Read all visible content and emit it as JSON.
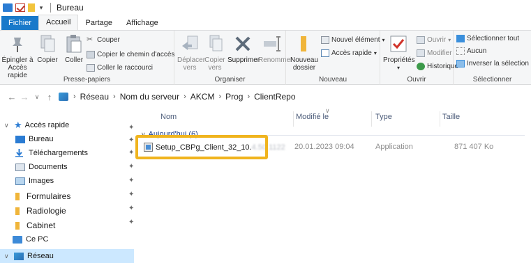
{
  "window": {
    "title": "Bureau"
  },
  "tabs": [
    "Fichier",
    "Accueil",
    "Partage",
    "Affichage"
  ],
  "ribbon": {
    "clipboard": {
      "pin_label": "Épingler à\nAccès rapide",
      "pin_line1": "Épingler à",
      "pin_line2": "Accès rapide",
      "copy": "Copier",
      "paste": "Coller",
      "cut": "Couper",
      "copy_path": "Copier le chemin d'accès",
      "paste_shortcut": "Coller le raccourci",
      "group": "Presse-papiers"
    },
    "organize": {
      "move_line1": "Déplacer",
      "move_line2": "vers",
      "copy_line1": "Copier",
      "copy_line2": "vers",
      "delete": "Supprimer",
      "rename": "Renommer",
      "group": "Organiser"
    },
    "new": {
      "new_folder_line1": "Nouveau",
      "new_folder_line2": "dossier",
      "new_item": "Nouvel élément",
      "quick_access": "Accès rapide",
      "group": "Nouveau"
    },
    "open": {
      "properties": "Propriétés",
      "open": "Ouvrir",
      "modify": "Modifier",
      "history": "Historique",
      "group": "Ouvrir"
    },
    "select": {
      "select_all": "Sélectionner tout",
      "none": "Aucun",
      "invert": "Inverser la sélection",
      "group": "Sélectionner"
    }
  },
  "breadcrumb": [
    "Réseau",
    "Nom du serveur",
    "AKCM",
    "Prog",
    "ClientRepo"
  ],
  "nav": {
    "quick_access": "Accès rapide",
    "items": [
      "Bureau",
      "Téléchargements",
      "Documents",
      "Images",
      "Formulaires",
      "Radiologie",
      "Cabinet"
    ],
    "this_pc": "Ce PC",
    "network": "Réseau"
  },
  "columns": {
    "name": "Nom",
    "modified": "Modifié le",
    "type": "Type",
    "size": "Taille"
  },
  "group_header": "Aujourd'hui (6)",
  "file": {
    "name": "Setup_CBPg_Client_32_10.",
    "name_blurred": "4.50.1122",
    "modified": "20.01.2023 09:04",
    "type": "Application",
    "size": "871 407 Ko"
  },
  "colors": {
    "accent": "#1979ca",
    "highlight": "#f0b41e",
    "selection": "#cce8ff"
  }
}
